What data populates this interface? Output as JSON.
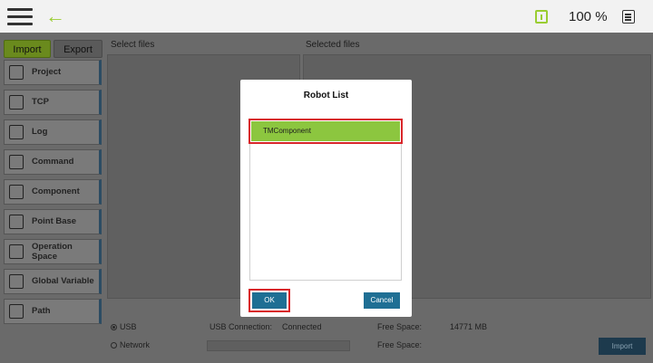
{
  "topbar": {
    "zoom": "100 %"
  },
  "icons": {
    "menu": "hamburger-icon",
    "back": "back-arrow-icon",
    "info": "info-icon",
    "doc": "document-icon"
  },
  "tabs": {
    "import": "Import",
    "export": "Export"
  },
  "sidebar": {
    "items": [
      {
        "label": "Project",
        "icon": "project-icon"
      },
      {
        "label": "TCP",
        "icon": "tcp-icon"
      },
      {
        "label": "Log",
        "icon": "log-icon"
      },
      {
        "label": "Command",
        "icon": "command-icon"
      },
      {
        "label": "Component",
        "icon": "component-icon"
      },
      {
        "label": "Point Base",
        "icon": "point-base-icon"
      },
      {
        "label": "Operation Space",
        "icon": "operation-space-icon"
      },
      {
        "label": "Global Variable",
        "icon": "global-variable-icon"
      },
      {
        "label": "Path",
        "icon": "path-icon"
      }
    ]
  },
  "panels": {
    "select_files": "Select files",
    "selected_files": "Selected files"
  },
  "bottom": {
    "usb": "USB",
    "network": "Network",
    "usb_connection_label": "USB Connection:",
    "usb_connection_value": "Connected",
    "free_space_label": "Free Space:",
    "free_space_value": "14771 MB",
    "free_space_label2": "Free Space:",
    "import_button": "Import"
  },
  "dialog": {
    "title": "Robot List",
    "items": [
      "TMComponent"
    ],
    "ok": "OK",
    "cancel": "Cancel"
  },
  "colors": {
    "accent_green": "#8cc63f",
    "highlight_red": "#d9262a",
    "button_blue": "#1f6f94"
  }
}
